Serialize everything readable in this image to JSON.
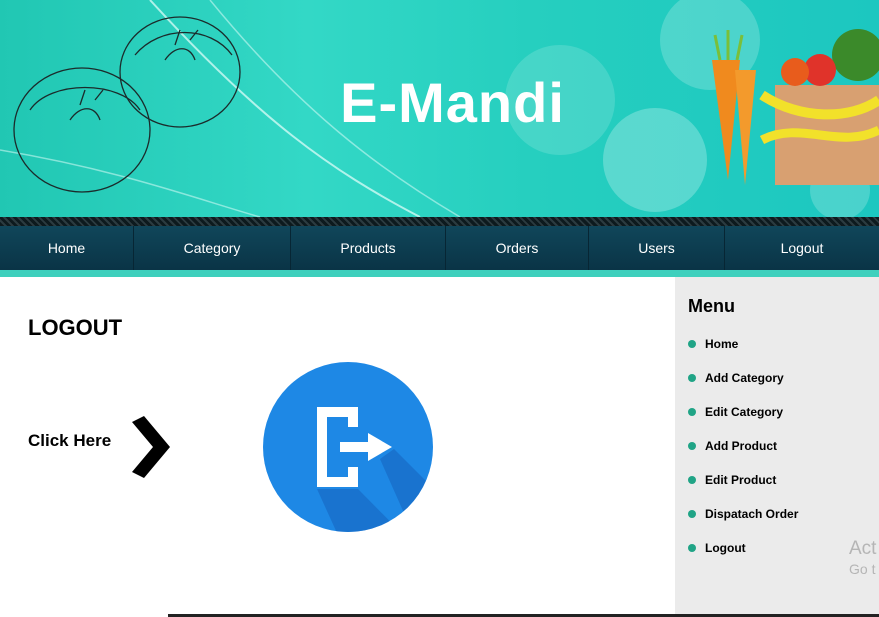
{
  "site": {
    "title": "E-Mandi"
  },
  "nav": {
    "items": [
      {
        "label": "Home"
      },
      {
        "label": "Category"
      },
      {
        "label": "Products"
      },
      {
        "label": "Orders"
      },
      {
        "label": "Users"
      },
      {
        "label": "Logout"
      }
    ]
  },
  "main": {
    "heading": "LOGOUT",
    "click_label": "Click Here",
    "logout_icon_color": "#1e88e5"
  },
  "sidebar": {
    "title": "Menu",
    "items": [
      {
        "label": "Home"
      },
      {
        "label": "Add Category"
      },
      {
        "label": "Edit Category"
      },
      {
        "label": "Add Product"
      },
      {
        "label": "Edit Product"
      },
      {
        "label": "Dispatach Order"
      },
      {
        "label": "Logout"
      }
    ],
    "bullet_color": "#20a486"
  },
  "watermark": {
    "line1": "Act",
    "line2": "Go t"
  },
  "colors": {
    "banner": "#26cfbf",
    "nav": "#0e3d50",
    "accent": "#3ed0bd"
  }
}
